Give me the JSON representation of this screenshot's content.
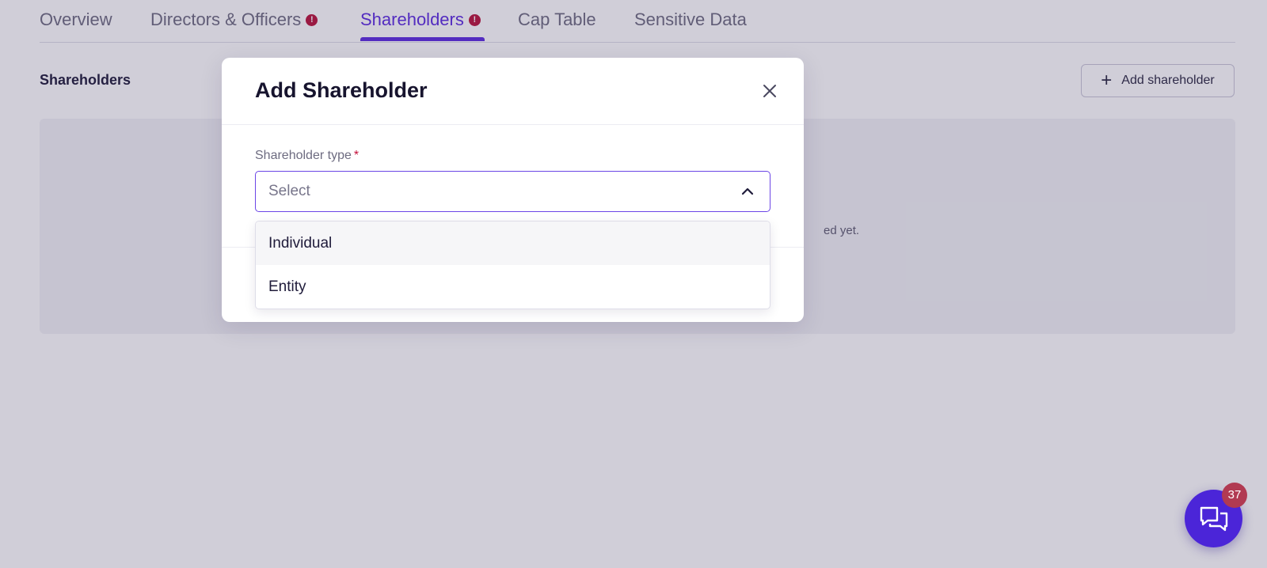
{
  "tabs": [
    {
      "label": "Overview",
      "alert": false
    },
    {
      "label": "Directors & Officers",
      "alert": true
    },
    {
      "label": "Shareholders",
      "alert": true,
      "active": true
    },
    {
      "label": "Cap Table",
      "alert": false
    },
    {
      "label": "Sensitive Data",
      "alert": false
    }
  ],
  "tab_alert_glyph": "!",
  "section": {
    "title": "Shareholders",
    "add_button_label": "Add shareholder",
    "add_button_icon": "plus-icon",
    "empty_text_fragment": "ed yet."
  },
  "modal": {
    "title": "Add Shareholder",
    "close_icon": "close-icon",
    "field_label": "Shareholder type",
    "required_marker": "*",
    "select_placeholder": "Select",
    "select_icon": "chevron-up-icon",
    "options": [
      "Individual",
      "Entity"
    ]
  },
  "chat": {
    "icon": "chat-bubbles-icon",
    "badge_count": "37"
  },
  "colors": {
    "accent": "#5b2be0",
    "alert": "#b8123a",
    "chat": "#4b25d8",
    "badge": "#b13a52"
  }
}
